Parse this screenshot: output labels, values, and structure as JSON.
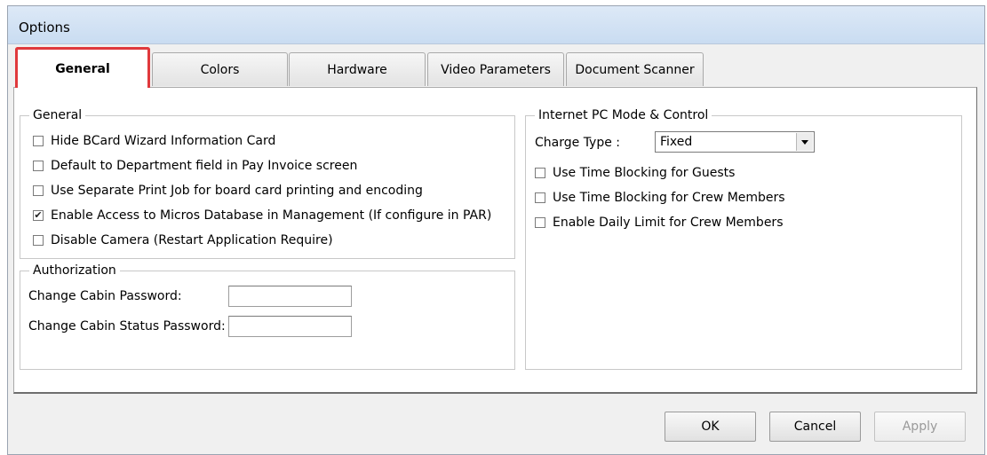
{
  "window": {
    "title": "Options"
  },
  "tabs": [
    {
      "label": "General",
      "active": true
    },
    {
      "label": "Colors"
    },
    {
      "label": "Hardware"
    },
    {
      "label": "Video Parameters"
    },
    {
      "label": "Document Scanner"
    }
  ],
  "general_group": {
    "title": "General",
    "options": [
      {
        "label": "Hide BCard Wizard Information Card",
        "checked": false
      },
      {
        "label": "Default to Department field in Pay Invoice screen",
        "checked": false
      },
      {
        "label": "Use Separate Print Job for board card printing and encoding",
        "checked": false
      },
      {
        "label": "Enable Access to Micros Database in Management (If configure in PAR)",
        "checked": true
      },
      {
        "label": "Disable Camera (Restart Application Require)",
        "checked": false
      }
    ]
  },
  "authorization_group": {
    "title": "Authorization",
    "cabin_password_label": "Change Cabin Password:",
    "cabin_password_value": "",
    "cabin_status_password_label": "Change Cabin Status Password:",
    "cabin_status_password_value": ""
  },
  "internet_group": {
    "title": "Internet PC Mode & Control",
    "charge_type_label": "Charge Type :",
    "charge_type_value": "Fixed",
    "options": [
      {
        "label": "Use Time Blocking for Guests",
        "checked": false
      },
      {
        "label": "Use Time Blocking for Crew Members",
        "checked": false
      },
      {
        "label": "Enable Daily Limit for Crew Members",
        "checked": false
      }
    ]
  },
  "buttons": {
    "ok": "OK",
    "cancel": "Cancel",
    "apply": "Apply"
  },
  "check_mark": "✔"
}
